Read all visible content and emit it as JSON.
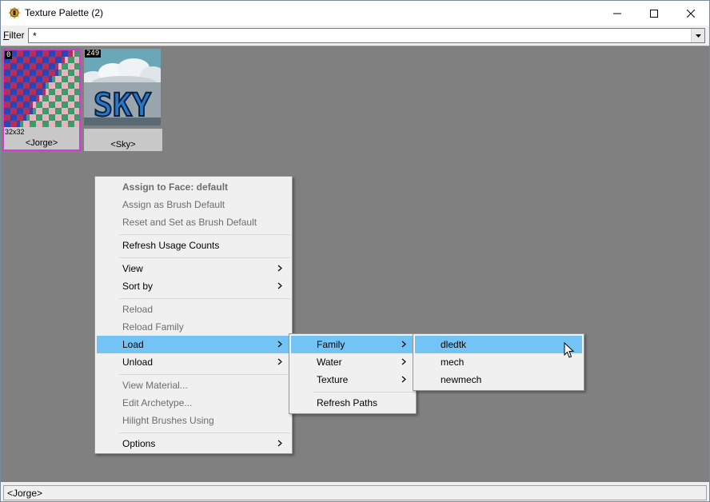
{
  "window": {
    "title": "Texture Palette (2)"
  },
  "filter": {
    "label_prefix": "F",
    "label_rest": "ilter",
    "value": "*"
  },
  "textures": [
    {
      "index": "0",
      "size": "32x32",
      "name": "<Jorge>"
    },
    {
      "index": "249",
      "name": "<Sky>",
      "image_text": "SKY"
    }
  ],
  "status": {
    "text": "<Jorge>"
  },
  "context_menu": {
    "items": [
      {
        "label": "Assign to Face: default"
      },
      {
        "label": "Assign as Brush Default"
      },
      {
        "label": "Reset and Set as Brush Default"
      },
      {
        "label": "Refresh Usage Counts"
      },
      {
        "label": "View"
      },
      {
        "label": "Sort by"
      },
      {
        "label": "Reload"
      },
      {
        "label": "Reload Family"
      },
      {
        "label": "Load"
      },
      {
        "label": "Unload"
      },
      {
        "label": "View Material..."
      },
      {
        "label": "Edit Archetype..."
      },
      {
        "label": "Hilight Brushes Using"
      },
      {
        "label": "Options"
      }
    ]
  },
  "load_submenu": {
    "items": [
      {
        "label": "Family"
      },
      {
        "label": "Water"
      },
      {
        "label": "Texture"
      },
      {
        "label": "Refresh Paths"
      }
    ]
  },
  "family_submenu": {
    "items": [
      {
        "label": "dledtk"
      },
      {
        "label": "mech"
      },
      {
        "label": "newmech"
      }
    ]
  },
  "colors": {
    "highlight": "#73c3f5",
    "selection_border": "#d23ad2",
    "canvas": "#808080"
  }
}
